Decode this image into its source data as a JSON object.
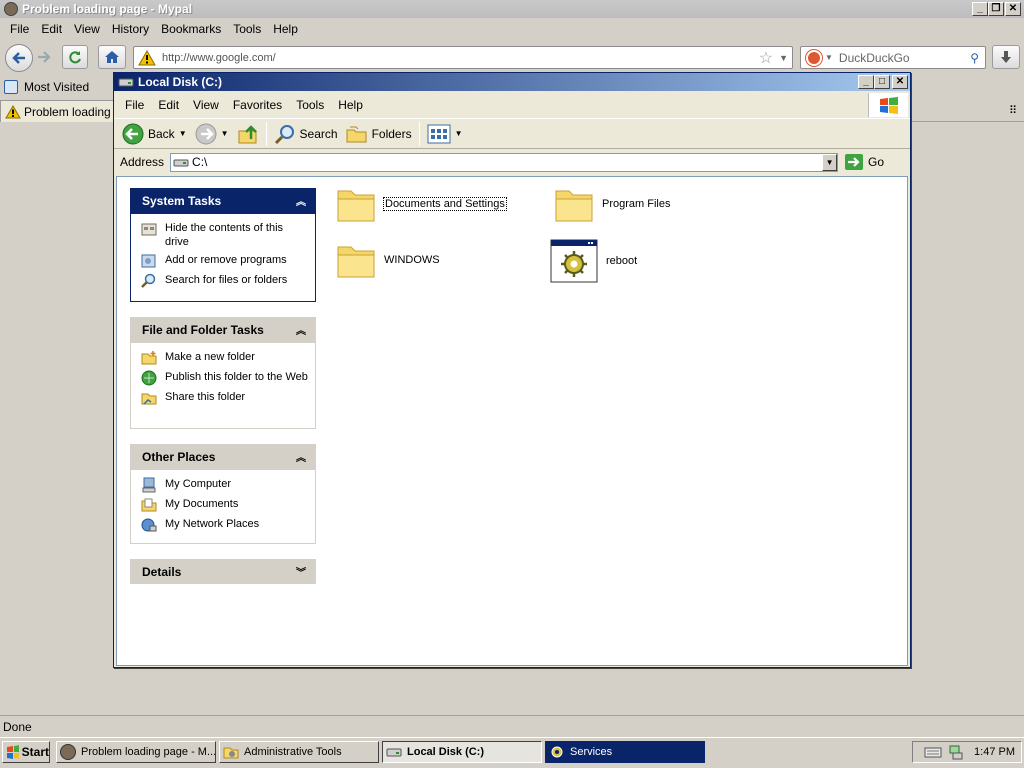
{
  "browser": {
    "title": "Problem loading page - Mypal",
    "menu": [
      "File",
      "Edit",
      "View",
      "History",
      "Bookmarks",
      "Tools",
      "Help"
    ],
    "url": "http://www.google.com/",
    "search_engine": "DuckDuckGo",
    "bookmarks": {
      "most_visited": "Most Visited"
    },
    "tab_title": "Problem loading page",
    "status": "Done"
  },
  "explorer": {
    "title": "Local Disk (C:)",
    "menu": [
      "File",
      "Edit",
      "View",
      "Favorites",
      "Tools",
      "Help"
    ],
    "toolbar": {
      "back": "Back",
      "search": "Search",
      "folders": "Folders"
    },
    "address_label": "Address",
    "address_value": "C:\\",
    "go_label": "Go",
    "panels": {
      "system_tasks": {
        "title": "System Tasks",
        "links": [
          "Hide the contents of this drive",
          "Add or remove programs",
          "Search for files or folders"
        ]
      },
      "file_folder_tasks": {
        "title": "File and Folder Tasks",
        "links": [
          "Make a new folder",
          "Publish this folder to the Web",
          "Share this folder"
        ]
      },
      "other_places": {
        "title": "Other Places",
        "links": [
          "My Computer",
          "My Documents",
          "My Network Places"
        ]
      },
      "details": {
        "title": "Details"
      }
    },
    "files": [
      "Documents and Settings",
      "Program Files",
      "WINDOWS",
      "reboot"
    ]
  },
  "taskbar": {
    "start": "Start",
    "buttons": [
      "Problem loading page - M...",
      "Administrative Tools",
      "Local Disk (C:)",
      "Services"
    ],
    "clock": "1:47 PM"
  },
  "colors": {
    "xp_blue": "#0a246a",
    "folder_yellow": "#f5d66b",
    "chrome_gray": "#d4d0c8"
  }
}
